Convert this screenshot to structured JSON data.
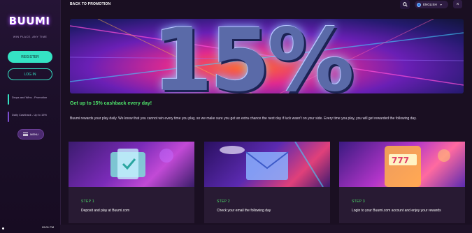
{
  "sidebar": {
    "logo": "BUUMI",
    "tagline": "WIN PLACE, ANY TIME",
    "register_label": "REGISTER",
    "login_label": "LOG IN",
    "promos": [
      {
        "label": "Drops and Wins - Promotion"
      },
      {
        "label": "Daily Cashback - Up to 15%"
      }
    ],
    "menu_label": "MENU"
  },
  "header": {
    "back_label": "BACK TO PROMOTION",
    "language": "ENGLISH"
  },
  "hero": {
    "text": "15%"
  },
  "promotion": {
    "headline": "Get up to 15% cashback every day!",
    "description": "Buumi rewards your play daily. We know that you cannot win every time you play, so we make sure you get an extra chance the next day if luck wasn't on your side. Every time you play, you will get rewarded the following day."
  },
  "steps": [
    {
      "title": "STEP 1",
      "text": "Deposit and play at Buumi.com"
    },
    {
      "title": "STEP 2",
      "text": "Check your email the following day"
    },
    {
      "title": "STEP 3",
      "text": "Login to your Buumi.com account and enjoy your rewards"
    }
  ],
  "taskbar": {
    "time": "09:01 PM"
  },
  "colors": {
    "accent": "#35e3c4",
    "headline_green": "#4ee26a",
    "background": "#1a0f22",
    "card_bg": "#281a33"
  }
}
